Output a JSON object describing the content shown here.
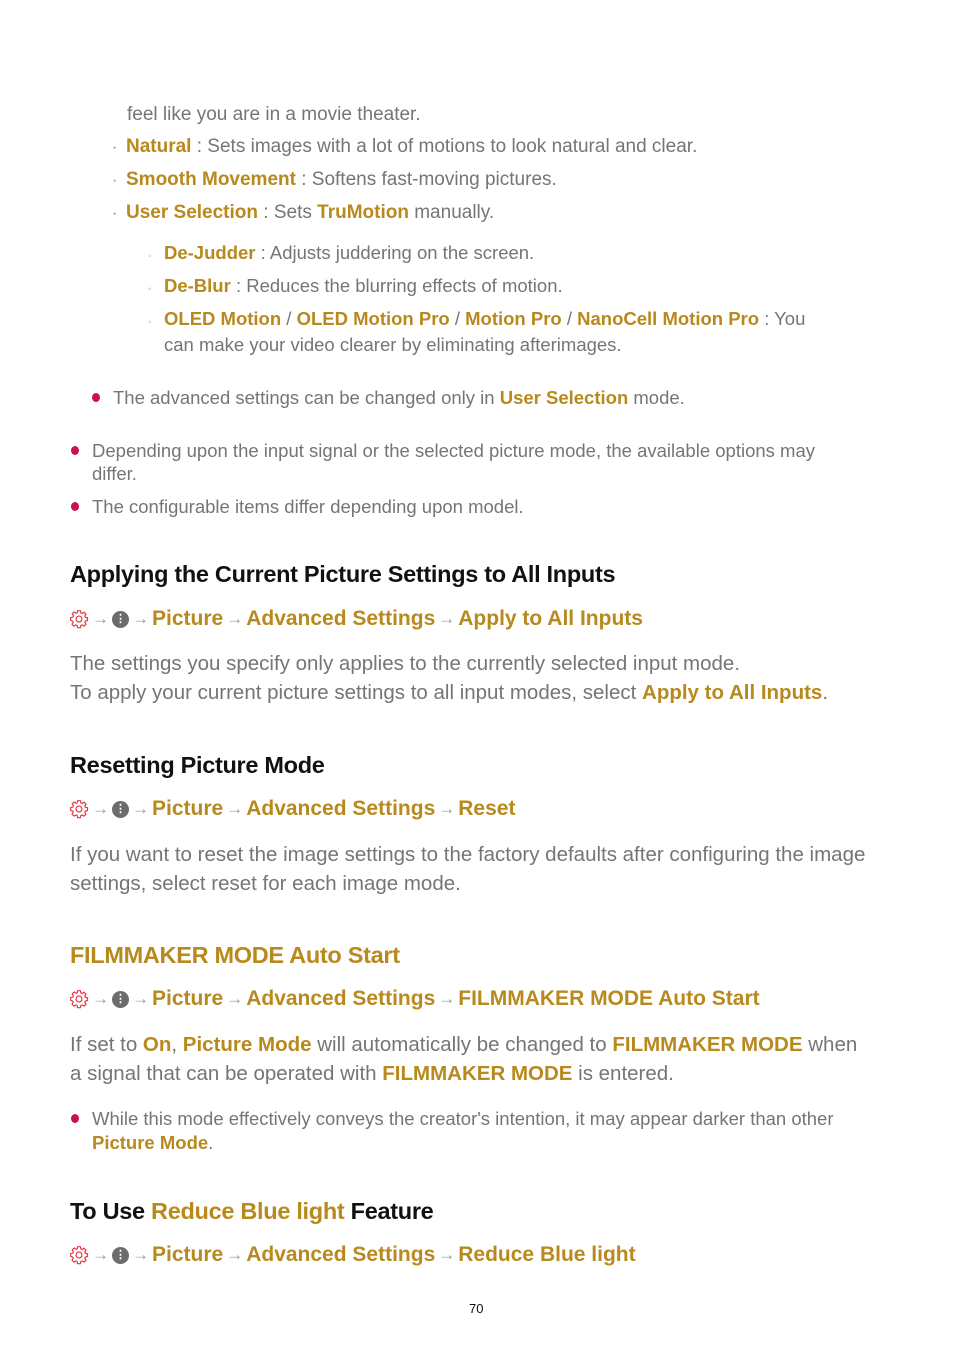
{
  "colors": {
    "highlight": "#b8891c",
    "bullet": "#c8144a",
    "text": "#757575",
    "heading": "#111111",
    "gear": "#e2383f"
  },
  "icons": {
    "settings": "gear-icon",
    "more": "more-options-icon",
    "arrow": "→"
  },
  "top": {
    "continuation": "feel like you are in a movie theater.",
    "options": [
      {
        "label": "Natural",
        "desc": " : Sets images with a lot of motions to look natural and clear."
      },
      {
        "label": "Smooth Movement",
        "desc": " : Softens fast-moving pictures."
      },
      {
        "label": "User Selection",
        "desc": " : Sets ",
        "label2": "TruMotion",
        "desc2": " manually."
      }
    ],
    "sub_options": [
      {
        "label": "De-Judder",
        "desc": " : Adjusts juddering on the screen."
      },
      {
        "label": "De-Blur",
        "desc": " : Reduces the blurring effects of motion."
      },
      {
        "labels": [
          "OLED Motion",
          "OLED Motion Pro",
          "Motion Pro",
          "NanoCell Motion Pro"
        ],
        "separator": " / ",
        "desc": " : You",
        "desc_line2": "can make your video clearer by eliminating afterimages."
      }
    ],
    "note": {
      "pre": "The advanced settings can be changed only in ",
      "hl": "User Selection",
      "post": " mode."
    },
    "notes": [
      {
        "line1": "Depending upon the input signal or the selected picture mode, the available options may",
        "line2": "differ."
      },
      {
        "line1": "The configurable items differ depending upon model."
      }
    ]
  },
  "sections": {
    "apply": {
      "title": "Applying the Current Picture Settings to All Inputs",
      "path": [
        "Picture",
        "Advanced Settings",
        "Apply to All Inputs"
      ],
      "line1": "The settings you specify only applies to the currently selected input mode.",
      "line2_pre": "To apply your current picture settings to all input modes, select ",
      "line2_hl": "Apply to All Inputs",
      "line2_post": "."
    },
    "reset": {
      "title": "Resetting Picture Mode",
      "path": [
        "Picture",
        "Advanced Settings",
        "Reset"
      ],
      "line1": "If you want to reset the image settings to the factory defaults after configuring the image",
      "line2": "settings, select reset for each image mode."
    },
    "filmmaker": {
      "title": "FILMMAKER MODE Auto Start",
      "path": [
        "Picture",
        "Advanced Settings",
        "FILMMAKER MODE Auto Start"
      ],
      "l1_a": "If set to ",
      "l1_b": "On",
      "l1_c": ", ",
      "l1_d": "Picture Mode",
      "l1_e": " will automatically be changed to ",
      "l1_f": "FILMMAKER MODE",
      "l1_g": " when",
      "l2_a": "a signal that can be operated with ",
      "l2_b": "FILMMAKER MODE",
      "l2_c": " is entered.",
      "note_line1": "While this mode effectively conveys the creator's intention, it may appear darker than other",
      "note_hl": "Picture Mode",
      "note_post": "."
    },
    "blue": {
      "title_pre": "To Use ",
      "title_hl": "Reduce Blue light",
      "title_post": " Feature",
      "path": [
        "Picture",
        "Advanced Settings",
        "Reduce Blue light"
      ]
    }
  },
  "page_number": "70"
}
